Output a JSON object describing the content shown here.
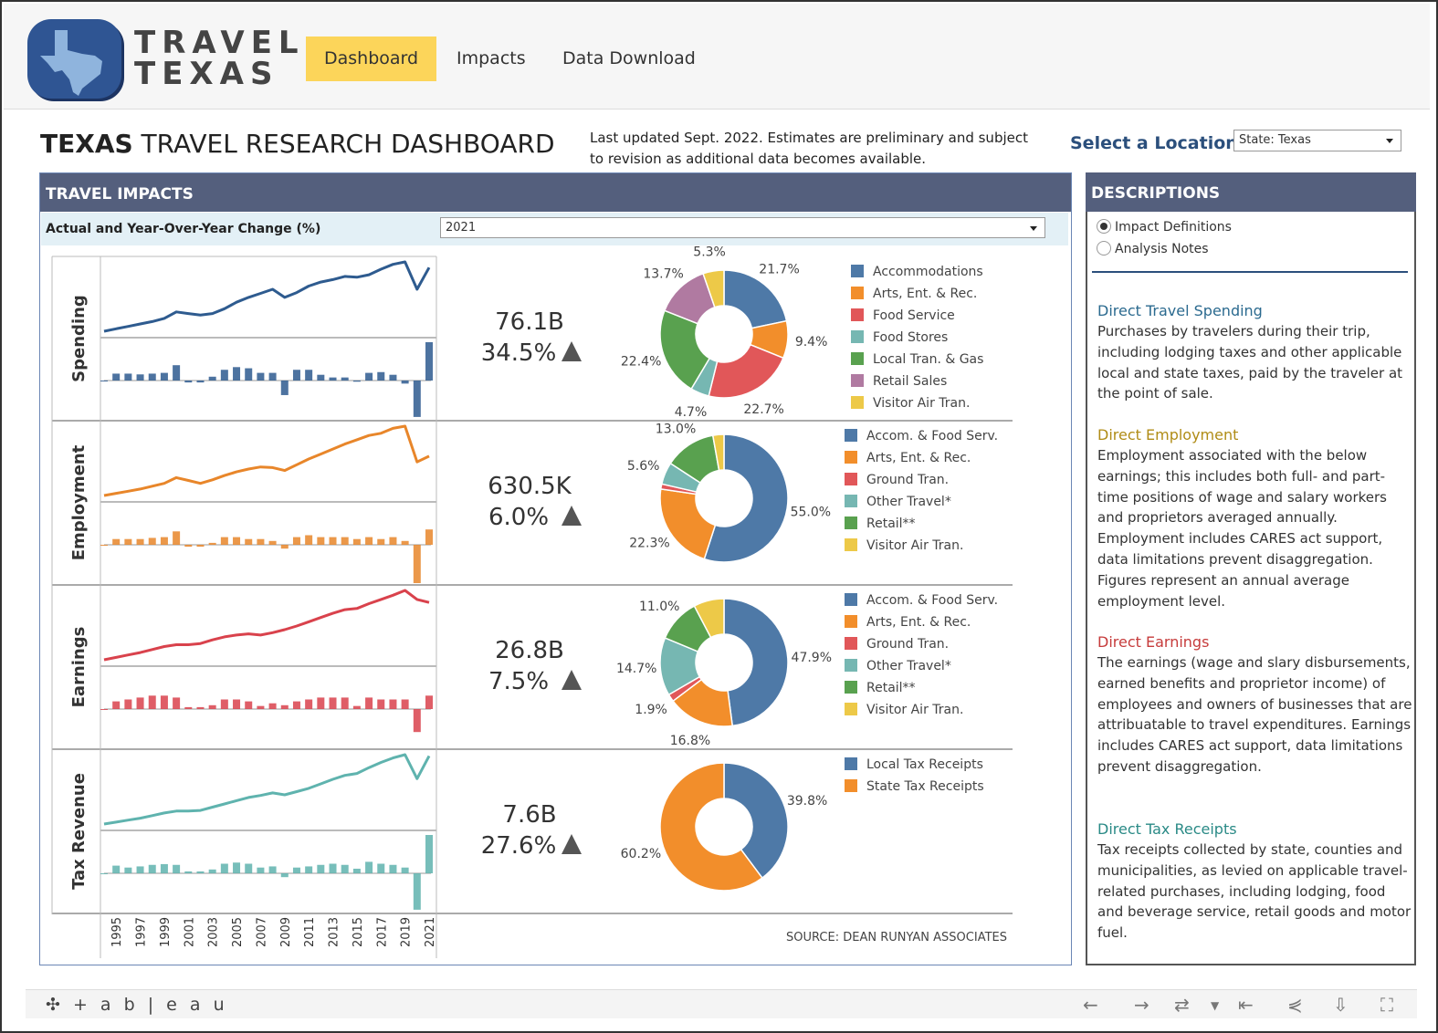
{
  "header": {
    "logo_text_1": "TRAVEL",
    "logo_text_2": "TEXAS",
    "nav": [
      "Dashboard",
      "Impacts",
      "Data Download"
    ]
  },
  "title": {
    "bold": "TEXAS",
    "rest": " TRAVEL RESEARCH DASHBOARD",
    "note": "Last updated Sept. 2022. Estimates are preliminary and subject to revision as additional data becomes available."
  },
  "location": {
    "label": "Select a Location",
    "value": "State: Texas"
  },
  "impacts": {
    "header": "TRAVEL IMPACTS",
    "yoy_label": "Actual and Year-Over-Year Change (%)",
    "year_value": "2021",
    "source": "SOURCE: DEAN RUNYAN ASSOCIATES"
  },
  "descriptions": {
    "header": "DESCRIPTIONS",
    "options": [
      "Impact Definitions",
      "Analysis Notes"
    ],
    "selected": "Impact Definitions",
    "items": [
      {
        "title": "Direct Travel Spending",
        "color": "#2b6a8f",
        "text": "Purchases by travelers during their trip, including lodging taxes and other applicable local and state taxes, paid by the traveler at the point of sale."
      },
      {
        "title": "Direct Employment",
        "color": "#b08c16",
        "text": "Employment associated with the below earnings; this includes both full- and part-time positions of wage and salary workers and proprietors averaged annually. Employment includes CARES act support, data limitations prevent disaggregation. Figures represent an annual average employment level."
      },
      {
        "title": "Direct Earnings",
        "color": "#c63b3b",
        "text": "The earnings (wage and slary disbursements, earned benefits and proprietor income) of employees and owners of businesses that are attribuatable to travel expenditures. Earnings includes CARES act support, data limitations prevent disaggregation."
      },
      {
        "title": "Direct Tax Receipts",
        "color": "#2a8a86",
        "text": "Tax receipts collected by state, counties and municipalities, as levied on applicable travel-related purchases, including lodging, food and beverage service, retail goods and motor fuel."
      }
    ]
  },
  "footer": {
    "brand": "+ a b | e a u"
  },
  "chart_data": [
    {
      "type": "line",
      "name": "Spending",
      "color": "#2e5b8f",
      "x": [
        1994,
        1995,
        1996,
        1997,
        1998,
        1999,
        2000,
        2001,
        2002,
        2003,
        2004,
        2005,
        2006,
        2007,
        2008,
        2009,
        2010,
        2011,
        2012,
        2013,
        2014,
        2015,
        2016,
        2017,
        2018,
        2019,
        2020,
        2021
      ],
      "values": [
        0.1,
        0.13,
        0.16,
        0.19,
        0.22,
        0.26,
        0.34,
        0.32,
        0.3,
        0.32,
        0.38,
        0.46,
        0.52,
        0.57,
        0.62,
        0.52,
        0.58,
        0.66,
        0.71,
        0.74,
        0.78,
        0.77,
        0.8,
        0.87,
        0.93,
        0.96,
        0.62,
        0.89
      ],
      "yoy": [
        0.0,
        0.18,
        0.18,
        0.16,
        0.18,
        0.2,
        0.4,
        -0.05,
        -0.05,
        0.1,
        0.28,
        0.35,
        0.32,
        0.2,
        0.2,
        -0.38,
        0.28,
        0.28,
        0.15,
        0.08,
        0.08,
        -0.03,
        0.2,
        0.22,
        0.15,
        -0.08,
        -0.95,
        1.0
      ],
      "kpi_value": "76.1B",
      "kpi_change": "34.5%",
      "donut": {
        "labels": [
          "Accommodations",
          "Arts, Ent. & Rec.",
          "Food Service",
          "Food Stores",
          "Local Tran. & Gas",
          "Retail Sales",
          "Visitor Air Tran."
        ],
        "values": [
          21.7,
          9.4,
          22.7,
          4.7,
          22.4,
          13.7,
          5.3
        ],
        "label_text": [
          "21.7%",
          "9.4%",
          "22.7%",
          "4.7%",
          "22.4%",
          "13.7%",
          "5.3%"
        ]
      }
    },
    {
      "type": "line",
      "name": "Employment",
      "color": "#e8862a",
      "x": [
        1994,
        1995,
        1996,
        1997,
        1998,
        1999,
        2000,
        2001,
        2002,
        2003,
        2004,
        2005,
        2006,
        2007,
        2008,
        2009,
        2010,
        2011,
        2012,
        2013,
        2014,
        2015,
        2016,
        2017,
        2018,
        2019,
        2020,
        2021
      ],
      "values": [
        0.05,
        0.08,
        0.11,
        0.14,
        0.18,
        0.22,
        0.3,
        0.26,
        0.22,
        0.27,
        0.33,
        0.38,
        0.42,
        0.45,
        0.44,
        0.4,
        0.48,
        0.56,
        0.63,
        0.7,
        0.77,
        0.83,
        0.89,
        0.92,
        0.99,
        1.02,
        0.52,
        0.6
      ],
      "yoy": [
        0.0,
        0.15,
        0.15,
        0.15,
        0.18,
        0.2,
        0.35,
        -0.05,
        -0.05,
        0.05,
        0.2,
        0.2,
        0.15,
        0.15,
        0.1,
        -0.1,
        0.2,
        0.25,
        0.2,
        0.2,
        0.2,
        0.15,
        0.2,
        0.15,
        0.2,
        0.1,
        -1.0,
        0.4
      ],
      "kpi_value": "630.5K",
      "kpi_change": "6.0%",
      "donut": {
        "labels": [
          "Accom. & Food Serv.",
          "Arts, Ent. & Rec.",
          "Ground Tran.",
          "Other Travel*",
          "Retail**",
          "Visitor Air Tran."
        ],
        "values": [
          55.0,
          22.3,
          1.3,
          5.6,
          13.0,
          2.8
        ],
        "label_text": [
          "55.0%",
          "22.3%",
          "",
          "5.6%",
          "13.0%",
          ""
        ]
      }
    },
    {
      "type": "line",
      "name": "Earnings",
      "color": "#d9424c",
      "x": [
        1994,
        1995,
        1996,
        1997,
        1998,
        1999,
        2000,
        2001,
        2002,
        2003,
        2004,
        2005,
        2006,
        2007,
        2008,
        2009,
        2010,
        2011,
        2012,
        2013,
        2014,
        2015,
        2016,
        2017,
        2018,
        2019,
        2020,
        2021
      ],
      "values": [
        0.05,
        0.09,
        0.13,
        0.17,
        0.22,
        0.27,
        0.3,
        0.3,
        0.32,
        0.38,
        0.43,
        0.46,
        0.48,
        0.46,
        0.5,
        0.55,
        0.61,
        0.68,
        0.75,
        0.82,
        0.88,
        0.9,
        0.98,
        1.05,
        1.12,
        1.2,
        1.05,
        1.0
      ],
      "yoy": [
        0.0,
        0.2,
        0.25,
        0.3,
        0.35,
        0.35,
        0.3,
        0.05,
        0.05,
        0.1,
        0.25,
        0.25,
        0.2,
        0.08,
        0.15,
        0.1,
        0.2,
        0.25,
        0.3,
        0.3,
        0.3,
        0.08,
        0.3,
        0.25,
        0.25,
        0.25,
        -0.6,
        0.35
      ],
      "kpi_value": "26.8B",
      "kpi_change": "7.5%",
      "donut": {
        "labels": [
          "Accom. & Food Serv.",
          "Arts, Ent. & Rec.",
          "Ground Tran.",
          "Other Travel*",
          "Retail**",
          "Visitor Air Tran."
        ],
        "values": [
          47.9,
          16.8,
          1.9,
          14.7,
          11.0,
          7.7
        ],
        "label_text": [
          "47.9%",
          "16.8%",
          "1.9%",
          "14.7%",
          "11.0%",
          ""
        ]
      }
    },
    {
      "type": "line",
      "name": "Tax Revenue",
      "color": "#5fb3ae",
      "x": [
        1994,
        1995,
        1996,
        1997,
        1998,
        1999,
        2000,
        2001,
        2002,
        2003,
        2004,
        2005,
        2006,
        2007,
        2008,
        2009,
        2010,
        2011,
        2012,
        2013,
        2014,
        2015,
        2016,
        2017,
        2018,
        2019,
        2020,
        2021
      ],
      "values": [
        0.1,
        0.13,
        0.16,
        0.19,
        0.23,
        0.27,
        0.3,
        0.3,
        0.31,
        0.36,
        0.41,
        0.46,
        0.51,
        0.54,
        0.58,
        0.55,
        0.6,
        0.65,
        0.72,
        0.79,
        0.85,
        0.88,
        0.97,
        1.05,
        1.12,
        1.17,
        0.8,
        1.15
      ],
      "yoy": [
        0.0,
        0.2,
        0.15,
        0.18,
        0.22,
        0.24,
        0.22,
        0.05,
        0.05,
        0.1,
        0.25,
        0.28,
        0.25,
        0.15,
        0.18,
        -0.1,
        0.15,
        0.18,
        0.22,
        0.25,
        0.22,
        0.12,
        0.3,
        0.25,
        0.22,
        0.15,
        -0.95,
        1.0
      ],
      "kpi_value": "7.6B",
      "kpi_change": "27.6%",
      "donut": {
        "labels": [
          "Local Tax Receipts",
          "State Tax Receipts"
        ],
        "values": [
          39.8,
          60.2
        ],
        "label_text": [
          "39.8%",
          "60.2%"
        ]
      }
    }
  ],
  "x_ticks": [
    "1995",
    "1997",
    "1999",
    "2001",
    "2003",
    "2005",
    "2007",
    "2009",
    "2011",
    "2013",
    "2015",
    "2017",
    "2019",
    "2021"
  ],
  "colors": {
    "accommodations": "#4e79a7",
    "arts": "#f28e2b",
    "food_service": "#e15759",
    "food_stores": "#76b7b2",
    "local_tran": "#59a14f",
    "retail_sales": "#b07aa1",
    "visitor_air": "#edc948",
    "accent": "#fcd55a",
    "header_bar": "#545f7d"
  }
}
